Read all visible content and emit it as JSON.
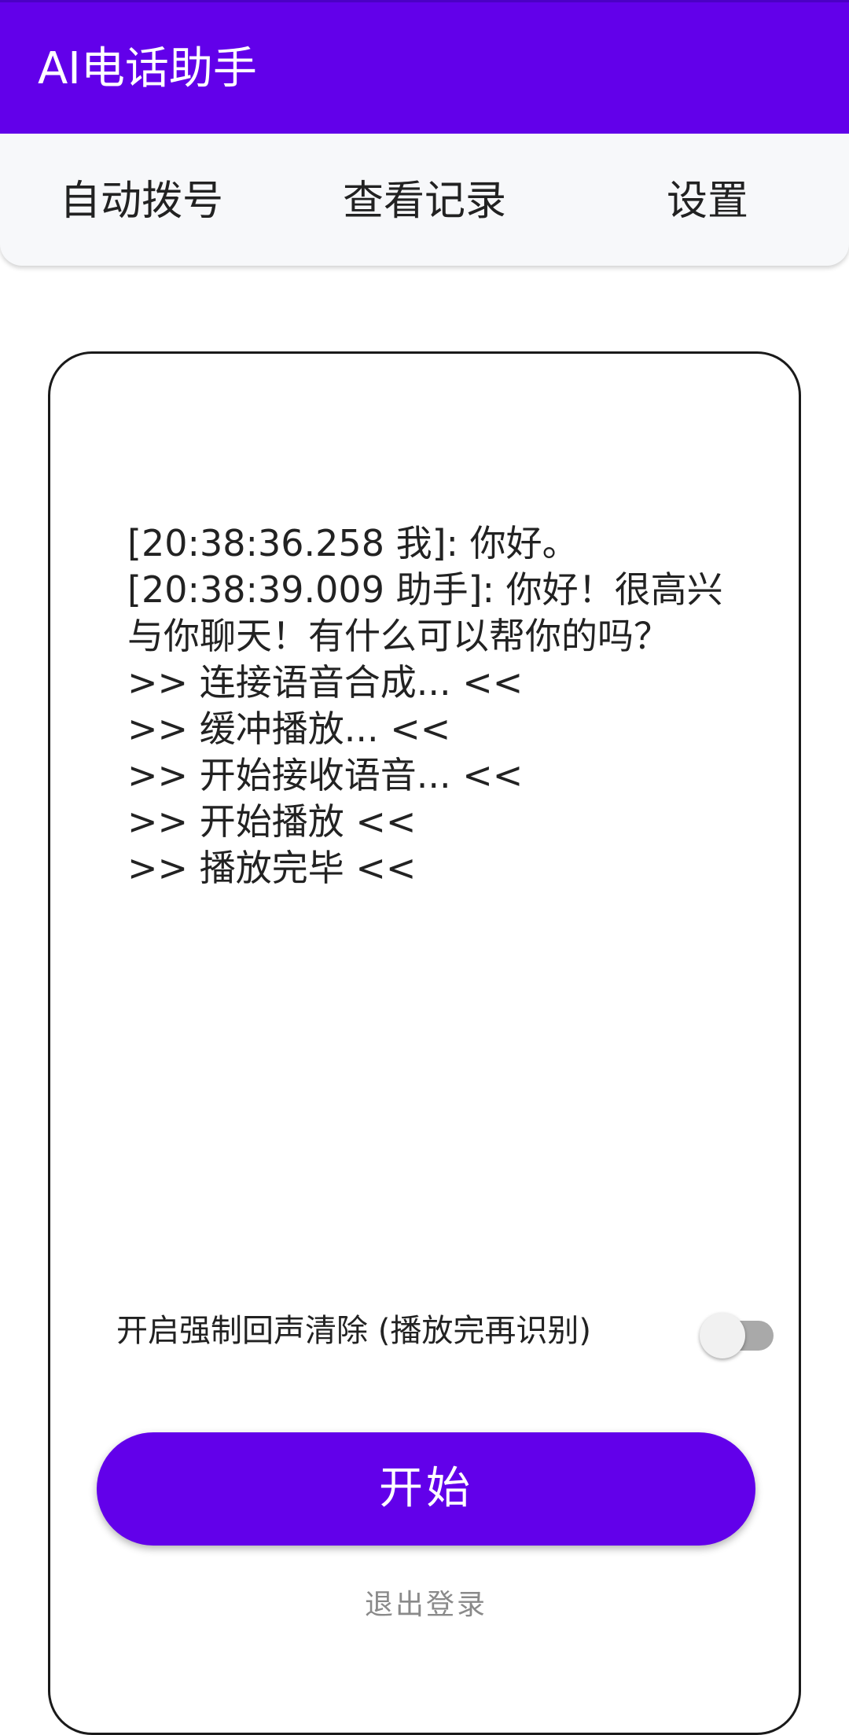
{
  "appbar": {
    "title": "AI电话助手",
    "color": "#6200ea"
  },
  "tabs": [
    {
      "label": "自动拨号"
    },
    {
      "label": "查看记录"
    },
    {
      "label": "设置"
    }
  ],
  "log": {
    "lines": [
      "[20:38:36.258 我]: 你好。",
      "[20:38:39.009 助手]: 你好！很高兴与你聊天！有什么可以帮你的吗？",
      ">> 连接语音合成... <<",
      ">> 缓冲播放... <<",
      ">> 开始接收语音... <<",
      ">> 开始播放 <<",
      ">> 播放完毕 <<"
    ]
  },
  "echo_cancel": {
    "label": "开启强制回声清除 (播放完再识别)",
    "enabled": false
  },
  "start_button": {
    "label": "开始"
  },
  "logout_link": {
    "label": "退出登录"
  }
}
